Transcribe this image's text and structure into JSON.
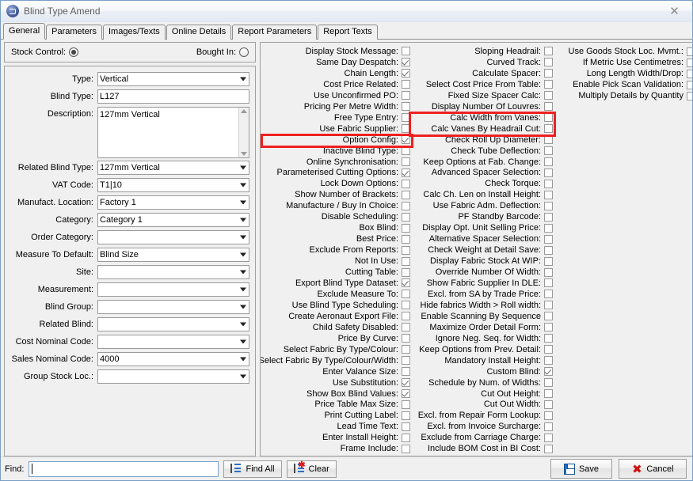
{
  "window": {
    "title": "Blind Type Amend",
    "close_label": "✕",
    "app_icon": "blind-app-icon"
  },
  "tabs": [
    {
      "label": "General",
      "active": true
    },
    {
      "label": "Parameters",
      "active": false
    },
    {
      "label": "Images/Texts",
      "active": false
    },
    {
      "label": "Online Details",
      "active": false
    },
    {
      "label": "Report Parameters",
      "active": false
    },
    {
      "label": "Report Texts",
      "active": false
    }
  ],
  "stock_control": {
    "stock_label": "Stock Control:",
    "stock_selected": true,
    "bought_in_label": "Bought In:",
    "bought_in_selected": false
  },
  "fields": [
    {
      "label": "Type:",
      "value": "Vertical",
      "type": "combo"
    },
    {
      "label": "Blind Type:",
      "value": "L127",
      "type": "text"
    },
    {
      "label": "Description:",
      "value": "127mm Vertical",
      "type": "memo"
    },
    {
      "label": "Related Blind Type:",
      "value": "127mm Vertical",
      "type": "combo"
    },
    {
      "label": "VAT Code:",
      "value": "T1|10",
      "type": "combo"
    },
    {
      "label": "Manufact. Location:",
      "value": "Factory 1",
      "type": "combo"
    },
    {
      "label": "Category:",
      "value": "Category 1",
      "type": "combo"
    },
    {
      "label": "Order Category:",
      "value": "",
      "type": "combo"
    },
    {
      "label": "Measure To Default:",
      "value": "Blind Size",
      "type": "combo"
    },
    {
      "label": "Site:",
      "value": "",
      "type": "combo"
    },
    {
      "label": "Measurement:",
      "value": "",
      "type": "combo"
    },
    {
      "label": "Blind Group:",
      "value": "",
      "type": "combo"
    },
    {
      "label": "Related Blind:",
      "value": "",
      "type": "combo"
    },
    {
      "label": "Cost Nominal Code:",
      "value": "",
      "type": "combo"
    },
    {
      "label": "Sales Nominal Code:",
      "value": "4000",
      "type": "combo"
    },
    {
      "label": "Group Stock Loc.:",
      "value": "",
      "type": "combo"
    }
  ],
  "checkbox_columns": [
    {
      "name": "column-1",
      "items": [
        {
          "label": "Display Stock Message:",
          "checked": false
        },
        {
          "label": "Same Day Despatch:",
          "checked": true
        },
        {
          "label": "Chain Length:",
          "checked": true
        },
        {
          "label": "Cost Price Related:",
          "checked": false
        },
        {
          "label": "Use Unconfirmed PO:",
          "checked": false
        },
        {
          "label": "Pricing Per Metre Width:",
          "checked": false
        },
        {
          "label": "Free Type Entry:",
          "checked": false
        },
        {
          "label": "Use Fabric Supplier:",
          "checked": false
        },
        {
          "label": "Option Config:",
          "checked": true,
          "highlight": true
        },
        {
          "label": "Inactive Blind Type:",
          "checked": false
        },
        {
          "label": "Online Synchronisation:",
          "checked": false
        },
        {
          "label": "Parameterised Cutting Options:",
          "checked": true
        },
        {
          "label": "Lock Down Options:",
          "checked": false
        },
        {
          "label": "Show Number of Brackets:",
          "checked": false
        },
        {
          "label": "Manufacture / Buy In Choice:",
          "checked": false
        },
        {
          "label": "Disable Scheduling:",
          "checked": false
        },
        {
          "label": "Box Blind:",
          "checked": false
        },
        {
          "label": "Best Price:",
          "checked": false
        },
        {
          "label": "Exclude From Reports:",
          "checked": false
        },
        {
          "label": "Not In Use:",
          "checked": false
        },
        {
          "label": "Cutting Table:",
          "checked": false
        },
        {
          "label": "Export Blind Type Dataset:",
          "checked": true
        },
        {
          "label": "Exclude Measure To:",
          "checked": false
        },
        {
          "label": "Use Blind Type Scheduling:",
          "checked": false
        },
        {
          "label": "Create Aeronaut Export File:",
          "checked": false
        },
        {
          "label": "Child Safety Disabled:",
          "checked": false
        },
        {
          "label": "Price By Curve:",
          "checked": false
        },
        {
          "label": "Select Fabric By Type/Colour:",
          "checked": false
        },
        {
          "label": "Select Fabric By Type/Colour/Width:",
          "checked": false
        },
        {
          "label": "Enter Valance Size:",
          "checked": false
        },
        {
          "label": "Use Substitution:",
          "checked": true
        },
        {
          "label": "Show Box Blind Values:",
          "checked": true
        },
        {
          "label": "Price Table Max Size:",
          "checked": false
        },
        {
          "label": "Print Cutting Label:",
          "checked": false
        },
        {
          "label": "Lead Time Text:",
          "checked": false
        },
        {
          "label": "Enter Install Height:",
          "checked": false
        },
        {
          "label": "Frame Include:",
          "checked": false
        }
      ]
    },
    {
      "name": "column-2",
      "items": [
        {
          "label": "Sloping Headrail:",
          "checked": false
        },
        {
          "label": "Curved Track:",
          "checked": false
        },
        {
          "label": "Calculate Spacer:",
          "checked": false
        },
        {
          "label": "Select Cost Price From Table:",
          "checked": false
        },
        {
          "label": "Fixed Size Spacer Calc:",
          "checked": false
        },
        {
          "label": "Display Number Of Louvres:",
          "checked": false
        },
        {
          "label": "Calc Width from Vanes:",
          "checked": false,
          "highlight": true
        },
        {
          "label": "Calc Vanes By Headrail Cut:",
          "checked": false,
          "highlight": true
        },
        {
          "label": "Check Roll Up Diameter:",
          "checked": false
        },
        {
          "label": "Check Tube Deflection:",
          "checked": false
        },
        {
          "label": "Keep Options at Fab. Change:",
          "checked": false
        },
        {
          "label": "Advanced Spacer Selection:",
          "checked": false
        },
        {
          "label": "Check Torque:",
          "checked": false
        },
        {
          "label": "Calc Ch. Len on Install Height:",
          "checked": false
        },
        {
          "label": "Use Fabric Adm. Deflection:",
          "checked": false
        },
        {
          "label": "PF Standby Barcode:",
          "checked": false
        },
        {
          "label": "Display Opt. Unit Selling Price:",
          "checked": false
        },
        {
          "label": "Alternative Spacer Selection:",
          "checked": false
        },
        {
          "label": "Check Weight at Detail Save:",
          "checked": false
        },
        {
          "label": "Display Fabric Stock At WIP:",
          "checked": false
        },
        {
          "label": "Override Number Of Width:",
          "checked": false
        },
        {
          "label": "Show Fabric Supplier In DLE:",
          "checked": false
        },
        {
          "label": "Excl. from SA by Trade Price:",
          "checked": false
        },
        {
          "label": "Hide fabrics Width > Roll width:",
          "checked": false
        },
        {
          "label": "Enable Scanning By Sequence",
          "checked": false
        },
        {
          "label": "Maximize Order Detail Form:",
          "checked": false
        },
        {
          "label": "Ignore Neg. Seq. for Width:",
          "checked": false
        },
        {
          "label": "Keep Options from Prev. Detail:",
          "checked": false
        },
        {
          "label": "Mandatory Install Height:",
          "checked": false
        },
        {
          "label": "Custom Blind:",
          "checked": true
        },
        {
          "label": "Schedule by Num. of Widths:",
          "checked": false
        },
        {
          "label": "Cut Out Height:",
          "checked": false
        },
        {
          "label": "Cut Out Width:",
          "checked": false
        },
        {
          "label": "Excl. from Repair Form Lookup:",
          "checked": false
        },
        {
          "label": "Excl. from Invoice Surcharge:",
          "checked": false
        },
        {
          "label": "Exclude from Carriage Charge:",
          "checked": false
        },
        {
          "label": "Include BOM Cost in BI Cost:",
          "checked": false
        }
      ]
    },
    {
      "name": "column-3",
      "items": [
        {
          "label": "Use Goods Stock Loc. Mvmt.:",
          "checked": false
        },
        {
          "label": "If Metric Use Centimetres:",
          "checked": false
        },
        {
          "label": "Long Length Width/Drop:",
          "checked": false
        },
        {
          "label": "Enable Pick Scan Validation:",
          "checked": false
        },
        {
          "label": "Multiply Details by Quantity",
          "checked": false
        }
      ]
    }
  ],
  "bottom": {
    "find_label": "Find:",
    "find_value": "",
    "find_all_label": "Find All",
    "clear_label": "Clear",
    "save_label": "Save",
    "cancel_label": "Cancel"
  },
  "colors": {
    "highlight": "#ef2020",
    "window_border": "#7a9fc4",
    "face": "#f0f0f0"
  }
}
